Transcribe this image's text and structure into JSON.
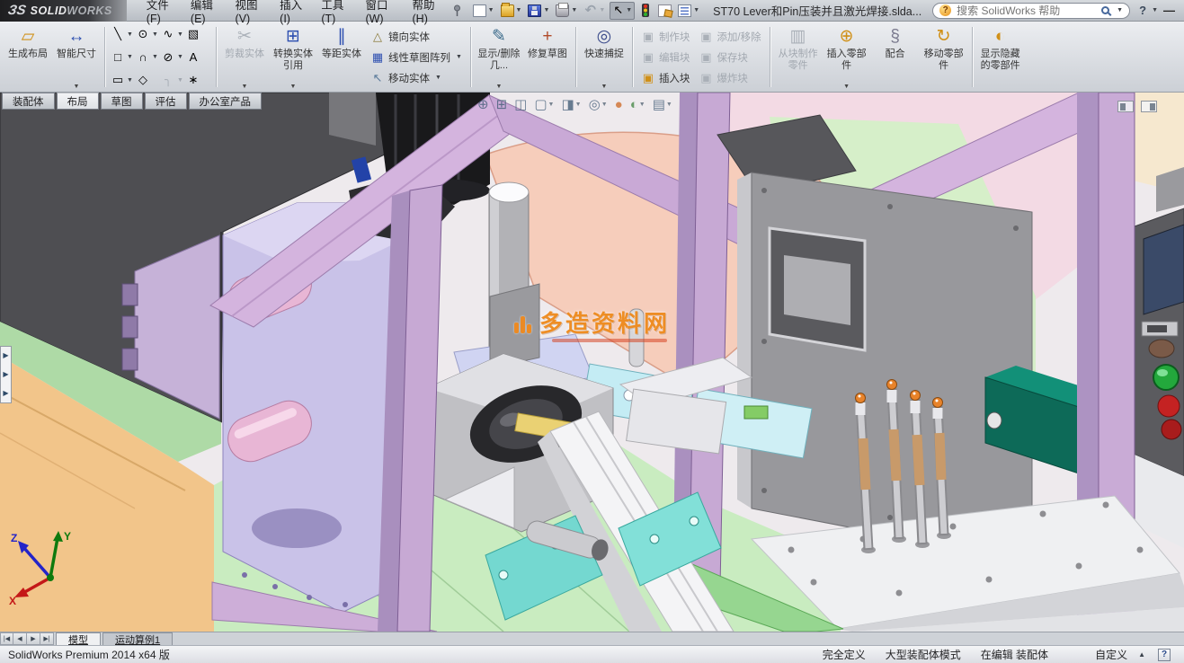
{
  "window": {
    "logo_mark": "ЗS",
    "logo_bold": "SOLID",
    "logo_light": "WORKS",
    "help_glyph": "?",
    "minimize_glyph": "—"
  },
  "menubar": {
    "items": [
      {
        "name": "file",
        "label": "文件(F)"
      },
      {
        "name": "edit",
        "label": "编辑(E)"
      },
      {
        "name": "view",
        "label": "视图(V)"
      },
      {
        "name": "insert",
        "label": "插入(I)"
      },
      {
        "name": "tools",
        "label": "工具(T)"
      },
      {
        "name": "window",
        "label": "窗口(W)"
      },
      {
        "name": "help",
        "label": "帮助(H)"
      }
    ]
  },
  "quickbar": {
    "items": [
      {
        "name": "new-document",
        "kind": "page",
        "dd": true
      },
      {
        "name": "open-document",
        "kind": "folder",
        "dd": true
      },
      {
        "name": "save-document",
        "kind": "floppy",
        "dd": true
      },
      {
        "name": "print-document",
        "kind": "printer",
        "dd": true
      },
      {
        "name": "undo",
        "kind": "undo",
        "dd": true,
        "disabled": true,
        "glyph": "↶"
      },
      {
        "name": "select-tool",
        "kind": "cursor",
        "dd": true,
        "pressed": true,
        "glyph": "↖"
      },
      {
        "name": "rebuild",
        "kind": "traffic"
      },
      {
        "name": "file-properties",
        "kind": "props"
      },
      {
        "name": "options",
        "kind": "options",
        "dd": true
      }
    ]
  },
  "document": {
    "title": "ST70 Lever和Pin压装并且激光焊接.slda..."
  },
  "search": {
    "placeholder": "搜索 SolidWorks 帮助"
  },
  "ribbon": {
    "groups": [
      {
        "t": "big",
        "name": "create-layout",
        "label": "生成布局",
        "g": "▱",
        "c": "#d09018"
      },
      {
        "t": "big",
        "name": "smart-dimension",
        "label": "智能尺寸",
        "g": "↔",
        "c": "#2d4fb0",
        "dd": true
      },
      {
        "t": "sep"
      },
      {
        "t": "grid",
        "name": "sketch-entities",
        "rows": [
          [
            {
              "name": "line",
              "g": "╲",
              "dd": true
            },
            {
              "name": "circle",
              "g": "⊙",
              "dd": true
            },
            {
              "name": "spline",
              "g": "∿",
              "dd": true
            },
            {
              "name": "selection-box",
              "g": "▧"
            }
          ],
          [
            {
              "name": "rectangle",
              "g": "□",
              "dd": true
            },
            {
              "name": "arc",
              "g": "∩",
              "dd": true
            },
            {
              "name": "ellipse",
              "g": "⊘",
              "dd": true
            },
            {
              "name": "sketch-text",
              "g": "A"
            }
          ],
          [
            {
              "name": "slot",
              "g": "▭",
              "dd": true
            },
            {
              "name": "polygon",
              "g": "◇"
            },
            {
              "name": "fillet",
              "g": "╮",
              "dd": true,
              "disabled": true
            },
            {
              "name": "point",
              "g": "∗"
            }
          ]
        ]
      },
      {
        "t": "sep"
      },
      {
        "t": "big",
        "name": "trim-entities",
        "label": "剪裁实体",
        "g": "✂",
        "disabled": true,
        "dd": true
      },
      {
        "t": "big",
        "name": "convert-entities",
        "label": "转换实体引用",
        "g": "⊞",
        "c": "#2d4fb0",
        "dd": true
      },
      {
        "t": "big",
        "name": "offset-entities",
        "label": "等距实体",
        "g": "∥",
        "c": "#2d4fb0"
      },
      {
        "t": "stack",
        "name": "sketch-tools-stack",
        "items": [
          {
            "name": "mirror-entities",
            "label": "镜向实体",
            "g": "△",
            "c": "#8a7a3a"
          },
          {
            "name": "linear-sketch-pattern",
            "label": "线性草图阵列",
            "g": "▦",
            "c": "#2d4fb0",
            "dd": true
          },
          {
            "name": "move-entities",
            "label": "移动实体",
            "g": "↖",
            "c": "#5a7a9a",
            "dd": true
          }
        ]
      },
      {
        "t": "sep"
      },
      {
        "t": "big",
        "name": "display-delete-relations",
        "label": "显示/删除几...",
        "g": "✎",
        "c": "#3a6a8a",
        "dd": true
      },
      {
        "t": "big",
        "name": "repair-sketch",
        "label": "修复草图",
        "g": "+",
        "c": "#b04a2a"
      },
      {
        "t": "sep"
      },
      {
        "t": "big",
        "name": "quick-snaps",
        "label": "快速捕捉",
        "g": "◎",
        "c": "#3a4a8a",
        "dd": true
      },
      {
        "t": "sep"
      },
      {
        "t": "stack",
        "name": "block-stack-1",
        "items": [
          {
            "name": "make-block",
            "label": "制作块",
            "g": "▣",
            "disabled": true
          },
          {
            "name": "edit-block",
            "label": "编辑块",
            "g": "▣",
            "disabled": true
          },
          {
            "name": "insert-block",
            "label": "插入块",
            "g": "▣",
            "c": "#d09018"
          }
        ]
      },
      {
        "t": "stack",
        "name": "block-stack-2",
        "items": [
          {
            "name": "add-remove-block",
            "label": "添加/移除",
            "g": "▣",
            "disabled": true
          },
          {
            "name": "save-block",
            "label": "保存块",
            "g": "▣",
            "disabled": true
          },
          {
            "name": "explode-block",
            "label": "爆炸块",
            "g": "▣",
            "disabled": true
          }
        ]
      },
      {
        "t": "sep"
      },
      {
        "t": "big",
        "name": "make-part-from-block",
        "label": "从块制作零件",
        "g": "▥",
        "disabled": true
      },
      {
        "t": "big",
        "name": "insert-components",
        "label": "插入零部件",
        "g": "⊕",
        "c": "#d09018",
        "dd": true
      },
      {
        "t": "big",
        "name": "mate",
        "label": "配合",
        "g": "§",
        "c": "#7a7a8e"
      },
      {
        "t": "big",
        "name": "move-component",
        "label": "移动零部件",
        "g": "↻",
        "c": "#d09018"
      },
      {
        "t": "sep"
      },
      {
        "t": "big",
        "name": "show-hidden-components",
        "label": "显示隐藏的零部件",
        "g": "◐",
        "c": "#d09018"
      }
    ]
  },
  "command_tabs": [
    {
      "name": "assembly",
      "label": "装配体"
    },
    {
      "name": "layout",
      "label": "布局",
      "active": true
    },
    {
      "name": "sketch",
      "label": "草图"
    },
    {
      "name": "evaluate",
      "label": "评估"
    },
    {
      "name": "office-products",
      "label": "办公室产品"
    }
  ],
  "hud": {
    "items": [
      {
        "name": "zoom-fit-icon",
        "g": "⊕"
      },
      {
        "name": "zoom-area-icon",
        "g": "⊞"
      },
      {
        "name": "section-view-icon",
        "g": "◫"
      },
      {
        "name": "view-orientation-icon",
        "g": "▢",
        "dd": true
      },
      {
        "name": "display-style-icon",
        "g": "◨",
        "dd": true
      },
      {
        "name": "hide-show-items-icon",
        "g": "◎",
        "dd": true
      },
      {
        "name": "edit-appearance-icon",
        "g": "●",
        "c": "#d07030"
      },
      {
        "name": "apply-scene-icon",
        "g": "◐",
        "c": "#4a8a4a",
        "dd": true
      },
      {
        "name": "view-settings-icon",
        "g": "▤",
        "dd": true
      }
    ]
  },
  "viewport": {
    "watermark_text": "多造资料网",
    "triad": {
      "x": "X",
      "y": "Y",
      "z": "Z"
    }
  },
  "sheet_tabs": {
    "nav": [
      "|◀",
      "◀",
      "▶",
      "▶|"
    ],
    "tabs": [
      {
        "name": "model",
        "label": "模型",
        "active": true
      },
      {
        "name": "motion-study-1",
        "label": "运动算例1",
        "active": false
      }
    ]
  },
  "statusbar": {
    "left": "SolidWorks Premium 2014 x64 版",
    "right": [
      {
        "name": "fully-defined",
        "label": "完全定义"
      },
      {
        "name": "large-assembly-mode",
        "label": "大型装配体模式"
      },
      {
        "name": "editing-state",
        "label": "在编辑 装配体"
      },
      {
        "name": "custom-toolbar",
        "label": "自定义",
        "custom": true
      }
    ]
  },
  "colors": {
    "frame_purple": "#c7a9d4",
    "floor_green": "#c9ecc0",
    "floor_tan": "#f2c58a",
    "disc_pink": "#f6cdbb",
    "teal_fixture": "#74d8d0",
    "watermark_orange": "#ee8a1c"
  }
}
